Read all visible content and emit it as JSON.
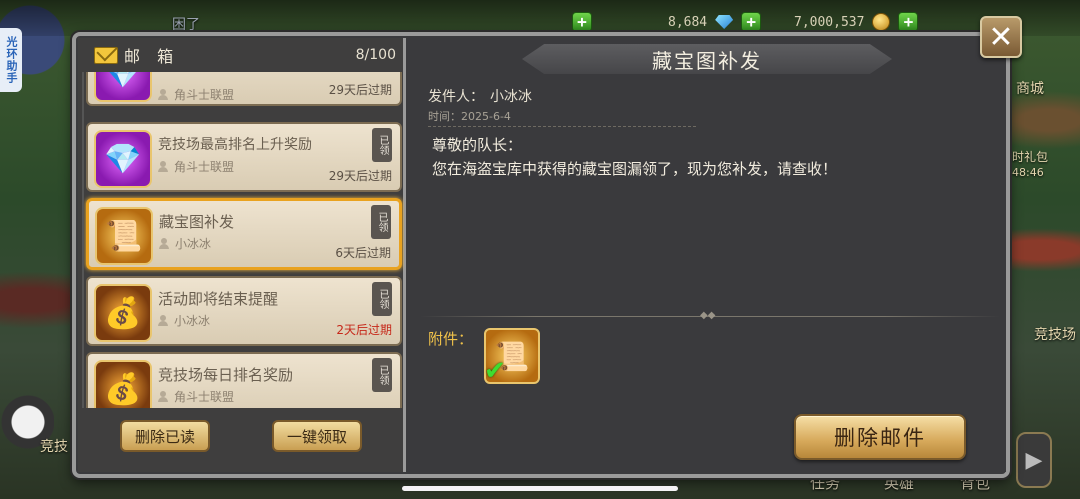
{
  "status_bar": {
    "top_left_fragment": "困了",
    "gems": "8,684",
    "gold": "7,000,537"
  },
  "side_tab": {
    "label": "光环助手"
  },
  "background_labels": {
    "shop": "商城",
    "gift": "时礼包",
    "timer": "48:46",
    "arena_right": "竞技场",
    "arena_left": "竞技",
    "bottom_tasks": "任务",
    "bottom_heroes": "英雄",
    "bottom_bag": "背包"
  },
  "mailbox": {
    "title": "邮 箱",
    "count": "8/100",
    "items": [
      {
        "subject": "",
        "sender": "角斗士联盟",
        "expire": "29天后过期",
        "expire_red": false,
        "claimed": "",
        "thumb": "gem"
      },
      {
        "subject": "竞技场最高排名上升奖励",
        "sender": "角斗士联盟",
        "expire": "29天后过期",
        "expire_red": false,
        "claimed": "已领",
        "thumb": "gem"
      },
      {
        "subject": "藏宝图补发",
        "sender": "小冰冰",
        "expire": "6天后过期",
        "expire_red": false,
        "claimed": "已领",
        "thumb": "map"
      },
      {
        "subject": "活动即将结束提醒",
        "sender": "小冰冰",
        "expire": "2天后过期",
        "expire_red": true,
        "claimed": "已领",
        "thumb": "bag"
      },
      {
        "subject": "竞技场每日排名奖励",
        "sender": "角斗士联盟",
        "expire": "",
        "expire_red": false,
        "claimed": "已领",
        "thumb": "bag"
      }
    ],
    "buttons": {
      "delete_read": "删除已读",
      "claim_all": "一键领取"
    }
  },
  "detail": {
    "title": "藏宝图补发",
    "sender_label": "发件人：",
    "sender_name": "小冰冰",
    "time_label": "时间：",
    "time_value": "2025-6-4",
    "greeting": "尊敬的队长：",
    "body": "您在海盗宝库中获得的藏宝图漏领了，现为您补发，请查收！",
    "attachment_label": "附件：",
    "delete_button": "删除邮件"
  },
  "colors": {
    "selected_border": "#e9a21f",
    "expire_red": "#c6281a",
    "attachment_label": "#f0c24a",
    "panel_bg": "#3a3a3d"
  },
  "icons": {
    "close": "close-icon",
    "envelope": "envelope-icon",
    "gem": "gem-icon",
    "coin": "coin-icon",
    "person": "person-icon",
    "check": "check-icon"
  }
}
